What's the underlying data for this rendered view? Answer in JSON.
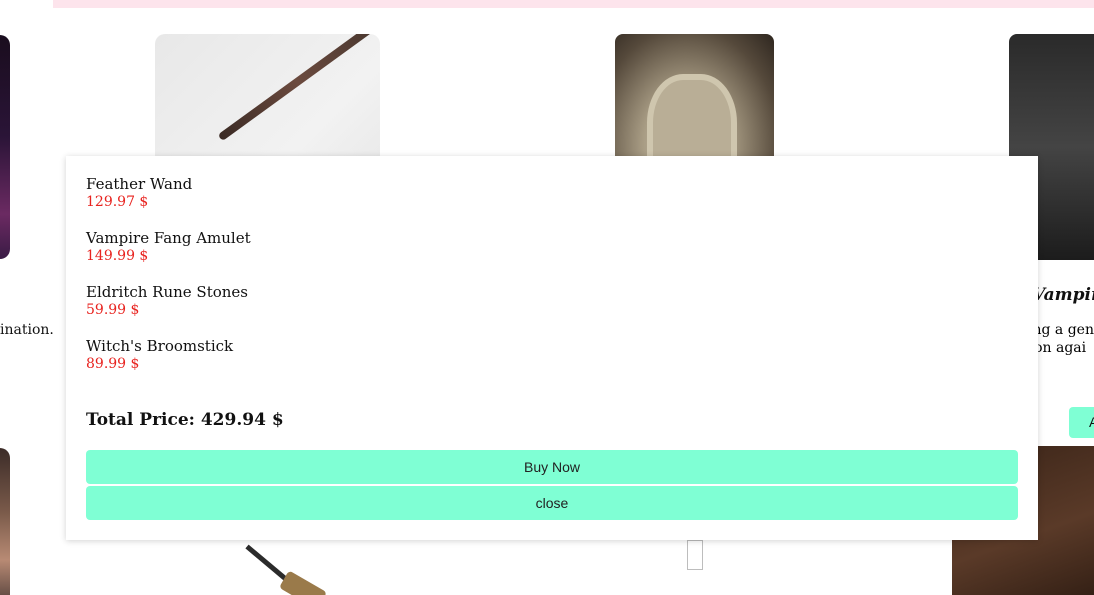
{
  "background": {
    "left_description_fragment": "ination.",
    "right_title_fragment": "Vampire",
    "right_desc_line1": "ing a gen",
    "right_desc_line2": "tion agai",
    "right_button_fragment": "A"
  },
  "cart": {
    "items": [
      {
        "name": "Feather Wand",
        "price": "129.97 $"
      },
      {
        "name": "Vampire Fang Amulet",
        "price": "149.99 $"
      },
      {
        "name": "Eldritch Rune Stones",
        "price": "59.99 $"
      },
      {
        "name": "Witch's Broomstick",
        "price": "89.99 $"
      }
    ],
    "total_label": "Total Price: 429.94 $",
    "buy_label": "Buy Now",
    "close_label": "close"
  },
  "colors": {
    "accent_button": "#7fffd4",
    "price_red": "#e8231f",
    "top_band": "#fde4ec"
  }
}
